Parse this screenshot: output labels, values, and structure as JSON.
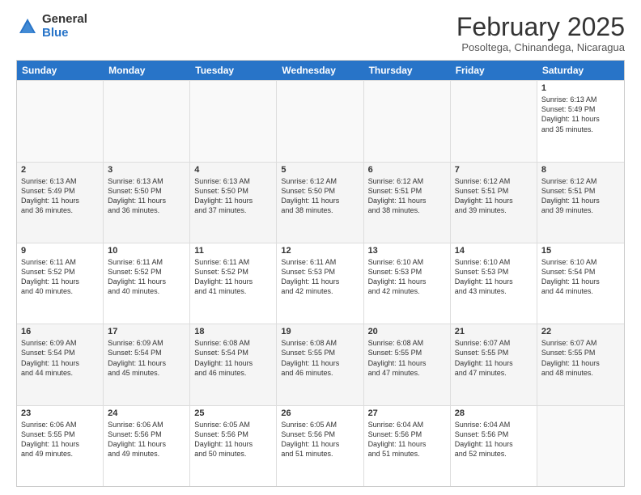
{
  "logo": {
    "general": "General",
    "blue": "Blue"
  },
  "title": "February 2025",
  "location": "Posoltega, Chinandega, Nicaragua",
  "days_of_week": [
    "Sunday",
    "Monday",
    "Tuesday",
    "Wednesday",
    "Thursday",
    "Friday",
    "Saturday"
  ],
  "weeks": [
    [
      {
        "day": "",
        "info": "",
        "empty": true
      },
      {
        "day": "",
        "info": "",
        "empty": true
      },
      {
        "day": "",
        "info": "",
        "empty": true
      },
      {
        "day": "",
        "info": "",
        "empty": true
      },
      {
        "day": "",
        "info": "",
        "empty": true
      },
      {
        "day": "",
        "info": "",
        "empty": true
      },
      {
        "day": "1",
        "info": "Sunrise: 6:13 AM\nSunset: 5:49 PM\nDaylight: 11 hours\nand 35 minutes."
      }
    ],
    [
      {
        "day": "2",
        "info": "Sunrise: 6:13 AM\nSunset: 5:49 PM\nDaylight: 11 hours\nand 36 minutes."
      },
      {
        "day": "3",
        "info": "Sunrise: 6:13 AM\nSunset: 5:50 PM\nDaylight: 11 hours\nand 36 minutes."
      },
      {
        "day": "4",
        "info": "Sunrise: 6:13 AM\nSunset: 5:50 PM\nDaylight: 11 hours\nand 37 minutes."
      },
      {
        "day": "5",
        "info": "Sunrise: 6:12 AM\nSunset: 5:50 PM\nDaylight: 11 hours\nand 38 minutes."
      },
      {
        "day": "6",
        "info": "Sunrise: 6:12 AM\nSunset: 5:51 PM\nDaylight: 11 hours\nand 38 minutes."
      },
      {
        "day": "7",
        "info": "Sunrise: 6:12 AM\nSunset: 5:51 PM\nDaylight: 11 hours\nand 39 minutes."
      },
      {
        "day": "8",
        "info": "Sunrise: 6:12 AM\nSunset: 5:51 PM\nDaylight: 11 hours\nand 39 minutes."
      }
    ],
    [
      {
        "day": "9",
        "info": "Sunrise: 6:11 AM\nSunset: 5:52 PM\nDaylight: 11 hours\nand 40 minutes."
      },
      {
        "day": "10",
        "info": "Sunrise: 6:11 AM\nSunset: 5:52 PM\nDaylight: 11 hours\nand 40 minutes."
      },
      {
        "day": "11",
        "info": "Sunrise: 6:11 AM\nSunset: 5:52 PM\nDaylight: 11 hours\nand 41 minutes."
      },
      {
        "day": "12",
        "info": "Sunrise: 6:11 AM\nSunset: 5:53 PM\nDaylight: 11 hours\nand 42 minutes."
      },
      {
        "day": "13",
        "info": "Sunrise: 6:10 AM\nSunset: 5:53 PM\nDaylight: 11 hours\nand 42 minutes."
      },
      {
        "day": "14",
        "info": "Sunrise: 6:10 AM\nSunset: 5:53 PM\nDaylight: 11 hours\nand 43 minutes."
      },
      {
        "day": "15",
        "info": "Sunrise: 6:10 AM\nSunset: 5:54 PM\nDaylight: 11 hours\nand 44 minutes."
      }
    ],
    [
      {
        "day": "16",
        "info": "Sunrise: 6:09 AM\nSunset: 5:54 PM\nDaylight: 11 hours\nand 44 minutes."
      },
      {
        "day": "17",
        "info": "Sunrise: 6:09 AM\nSunset: 5:54 PM\nDaylight: 11 hours\nand 45 minutes."
      },
      {
        "day": "18",
        "info": "Sunrise: 6:08 AM\nSunset: 5:54 PM\nDaylight: 11 hours\nand 46 minutes."
      },
      {
        "day": "19",
        "info": "Sunrise: 6:08 AM\nSunset: 5:55 PM\nDaylight: 11 hours\nand 46 minutes."
      },
      {
        "day": "20",
        "info": "Sunrise: 6:08 AM\nSunset: 5:55 PM\nDaylight: 11 hours\nand 47 minutes."
      },
      {
        "day": "21",
        "info": "Sunrise: 6:07 AM\nSunset: 5:55 PM\nDaylight: 11 hours\nand 47 minutes."
      },
      {
        "day": "22",
        "info": "Sunrise: 6:07 AM\nSunset: 5:55 PM\nDaylight: 11 hours\nand 48 minutes."
      }
    ],
    [
      {
        "day": "23",
        "info": "Sunrise: 6:06 AM\nSunset: 5:55 PM\nDaylight: 11 hours\nand 49 minutes."
      },
      {
        "day": "24",
        "info": "Sunrise: 6:06 AM\nSunset: 5:56 PM\nDaylight: 11 hours\nand 49 minutes."
      },
      {
        "day": "25",
        "info": "Sunrise: 6:05 AM\nSunset: 5:56 PM\nDaylight: 11 hours\nand 50 minutes."
      },
      {
        "day": "26",
        "info": "Sunrise: 6:05 AM\nSunset: 5:56 PM\nDaylight: 11 hours\nand 51 minutes."
      },
      {
        "day": "27",
        "info": "Sunrise: 6:04 AM\nSunset: 5:56 PM\nDaylight: 11 hours\nand 51 minutes."
      },
      {
        "day": "28",
        "info": "Sunrise: 6:04 AM\nSunset: 5:56 PM\nDaylight: 11 hours\nand 52 minutes."
      },
      {
        "day": "",
        "info": "",
        "empty": true
      }
    ]
  ]
}
